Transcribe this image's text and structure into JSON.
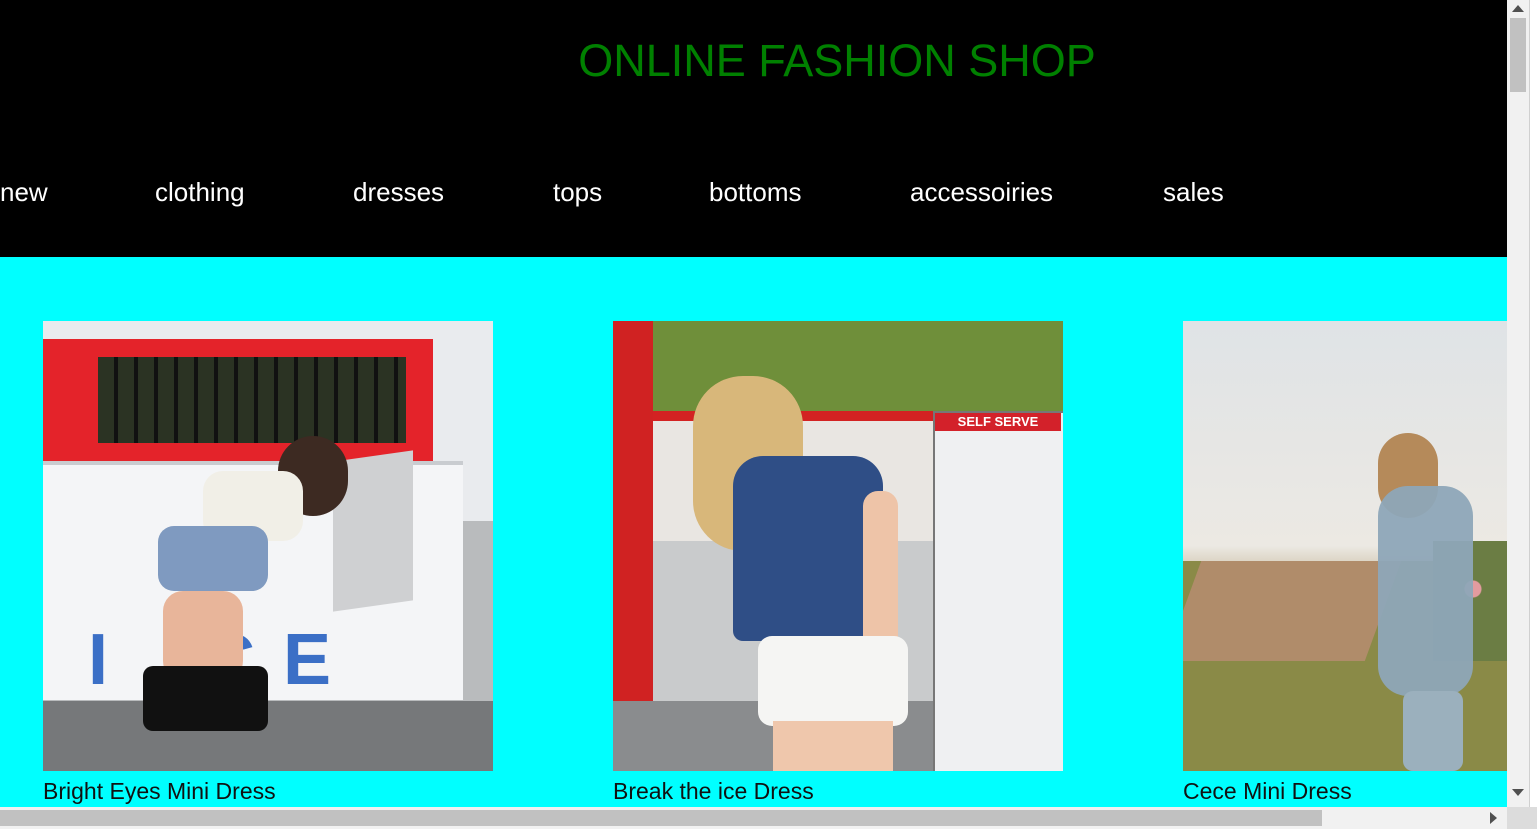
{
  "header": {
    "title": "ONLINE FASHION SHOP",
    "title_color": "#008000",
    "background": "#000000"
  },
  "nav": {
    "items": [
      {
        "label": "new"
      },
      {
        "label": "clothing"
      },
      {
        "label": "dresses"
      },
      {
        "label": "tops"
      },
      {
        "label": "bottoms"
      },
      {
        "label": "accessoiries"
      },
      {
        "label": "sales"
      }
    ]
  },
  "content": {
    "background": "#00ffff",
    "products": [
      {
        "name": "Bright Eyes Mini Dress"
      },
      {
        "name": "Break the ice Dress"
      },
      {
        "name": "Cece Mini Dress"
      }
    ]
  },
  "photo_text": {
    "ice_letters": [
      "I",
      "C",
      "E"
    ],
    "self_serve": "SELF SERVE"
  }
}
